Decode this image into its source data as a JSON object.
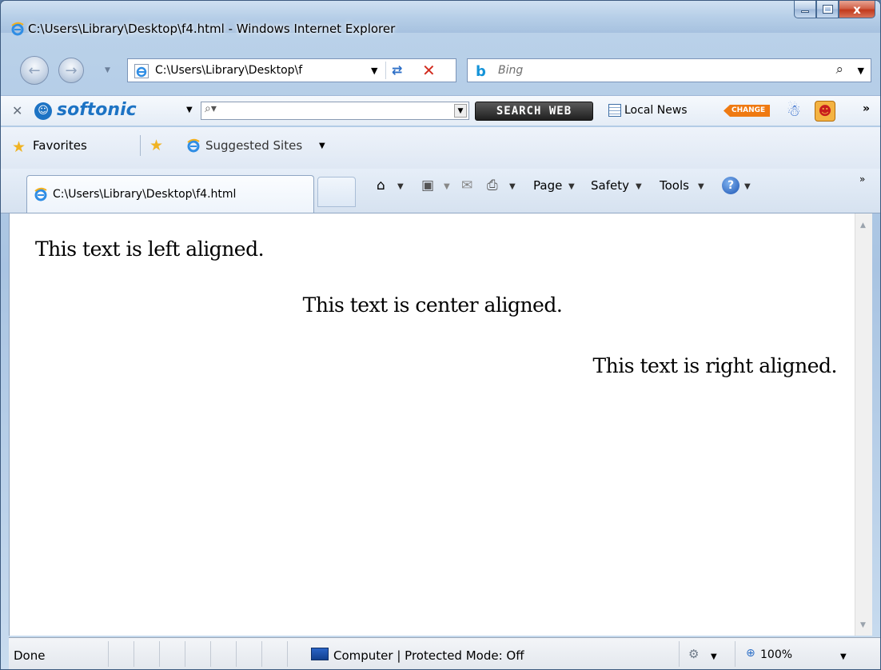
{
  "window": {
    "title": "C:\\Users\\Library\\Desktop\\f4.html - Windows Internet Explorer",
    "minimize_glyph": "",
    "close_glyph": "x"
  },
  "address_bar": {
    "url": "C:\\Users\\Library\\Desktop\\f"
  },
  "search": {
    "provider": "Bing",
    "placeholder": "Bing"
  },
  "softonic_toolbar": {
    "logo": "softonic",
    "search_web_label": "SEARCH WEB",
    "local_news_label": "Local News",
    "change_badge": "CHANGE"
  },
  "favorites_bar": {
    "favorites_label": "Favorites",
    "suggested_sites_label": "Suggested Sites"
  },
  "tab": {
    "title": "C:\\Users\\Library\\Desktop\\f4.html"
  },
  "command_bar": {
    "page_label": "Page",
    "safety_label": "Safety",
    "tools_label": "Tools"
  },
  "content": {
    "left_text": "This text is left aligned.",
    "center_text": "This text is center aligned.",
    "right_text": "This text is right aligned."
  },
  "status_bar": {
    "status": "Done",
    "zone": "Computer | Protected Mode: Off",
    "zoom": "100%"
  },
  "colors": {
    "accent_blue": "#1d73c4",
    "stop_red": "#d22c1f",
    "change_orange": "#ef7a12"
  }
}
